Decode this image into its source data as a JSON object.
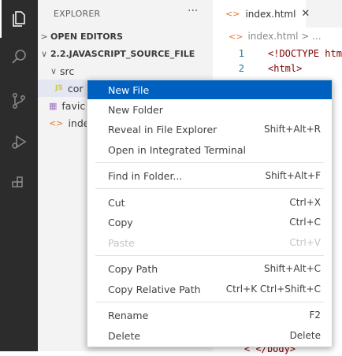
{
  "activity_bar": {
    "items": [
      {
        "icon": "explorer-icon",
        "active": true
      },
      {
        "icon": "search-icon"
      },
      {
        "icon": "source-control-icon"
      },
      {
        "icon": "run-debug-icon"
      },
      {
        "icon": "extensions-icon"
      }
    ]
  },
  "sidebar": {
    "title": "EXPLORER",
    "more": "···",
    "open_editors": "OPEN EDITORS",
    "project": "2.2.JAVASCRIPT_SOURCE_FILE",
    "tree": [
      {
        "label": "src",
        "type": "folder"
      },
      {
        "label": "cor",
        "type": "js"
      },
      {
        "label": "favic",
        "type": "image"
      },
      {
        "label": "index",
        "type": "html"
      }
    ]
  },
  "editor": {
    "tab_label": "index.html",
    "tab_close": "✕",
    "breadcrumb": "index.html > ...",
    "lines": [
      {
        "n": "1",
        "text": "<!DOCTYPE htm"
      },
      {
        "n": "2",
        "text": "<html>"
      }
    ],
    "bottom_line_fragment": "<    </body>"
  },
  "context_menu": {
    "groups": [
      [
        {
          "label": "New File",
          "shortcut": "",
          "highlight": true
        },
        {
          "label": "New Folder",
          "shortcut": ""
        },
        {
          "label": "Reveal in File Explorer",
          "shortcut": "Shift+Alt+R"
        },
        {
          "label": "Open in Integrated Terminal",
          "shortcut": ""
        }
      ],
      [
        {
          "label": "Find in Folder...",
          "shortcut": "Shift+Alt+F"
        }
      ],
      [
        {
          "label": "Cut",
          "shortcut": "Ctrl+X"
        },
        {
          "label": "Copy",
          "shortcut": "Ctrl+C"
        },
        {
          "label": "Paste",
          "shortcut": "Ctrl+V",
          "disabled": true
        }
      ],
      [
        {
          "label": "Copy Path",
          "shortcut": "Shift+Alt+C"
        },
        {
          "label": "Copy Relative Path",
          "shortcut": "Ctrl+K Ctrl+Shift+C"
        }
      ],
      [
        {
          "label": "Rename",
          "shortcut": "F2"
        },
        {
          "label": "Delete",
          "shortcut": "Delete"
        }
      ]
    ]
  },
  "colors": {
    "activity_bar": "#2c2c2c",
    "sidebar": "#f3f3f3",
    "menu_highlight": "#0060c0"
  }
}
